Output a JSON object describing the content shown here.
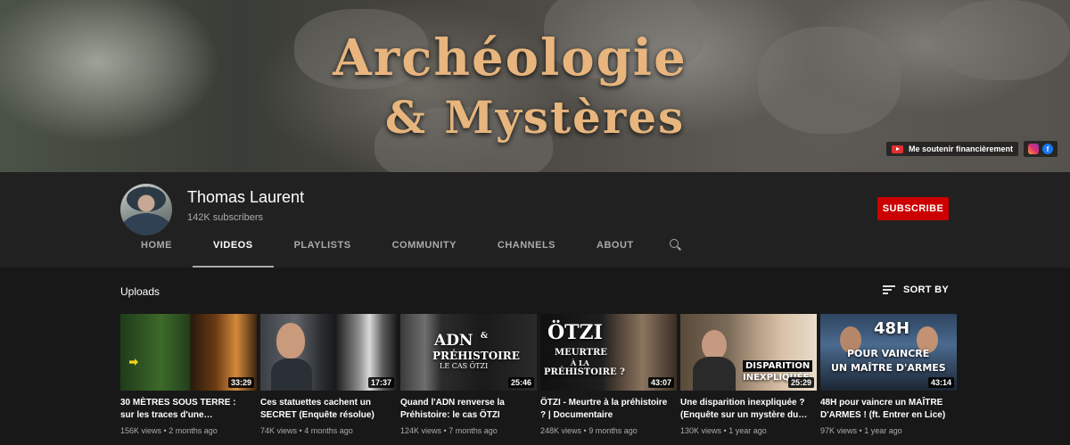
{
  "banner": {
    "title_line1": "Archéologie",
    "title_line2": "& Mystères",
    "support_link": "Me soutenir financièrement",
    "icons": [
      "youtube-icon",
      "instagram-icon",
      "facebook-icon"
    ]
  },
  "channel": {
    "name": "Thomas Laurent",
    "subscribers": "142K subscribers",
    "subscribe_label": "SUBSCRIBE"
  },
  "tabs": [
    {
      "label": "HOME"
    },
    {
      "label": "VIDEOS"
    },
    {
      "label": "PLAYLISTS"
    },
    {
      "label": "COMMUNITY"
    },
    {
      "label": "CHANNELS"
    },
    {
      "label": "ABOUT"
    }
  ],
  "active_tab": "VIDEOS",
  "uploads": {
    "title": "Uploads",
    "sort_label": "SORT BY",
    "videos": [
      {
        "title": "30 MÈTRES SOUS TERRE : sur les traces d'une…",
        "views": "156K views",
        "age": "2 months ago",
        "duration": "33:29",
        "overlay": ""
      },
      {
        "title": "Ces statuettes cachent un SECRET (Enquête résolue)",
        "views": "74K views",
        "age": "4 months ago",
        "duration": "17:37",
        "overlay": ""
      },
      {
        "title": "Quand l'ADN renverse la Préhistoire: le cas ÖTZI",
        "views": "124K views",
        "age": "7 months ago",
        "duration": "25:46",
        "overlay_l1": "ADN",
        "overlay_l2": "&",
        "overlay_l3": "PRÉHISTOIRE",
        "overlay_l4": "LE CAS ÖTZI"
      },
      {
        "title": "ÖTZI - Meurtre à la préhistoire ? | Documentaire",
        "views": "248K views",
        "age": "9 months ago",
        "duration": "43:07",
        "overlay_l1": "ÖTZI",
        "overlay_l2": "MEURTRE",
        "overlay_l3": "À LA",
        "overlay_l4": "PRÉHISTOIRE ?"
      },
      {
        "title": "Une disparition inexpliquée ? (Enquête sur un mystère du…",
        "views": "130K views",
        "age": "1 year ago",
        "duration": "25:29",
        "overlay_l1": "DISPARITION",
        "overlay_l2": "INEXPLIQUÉE"
      },
      {
        "title": "48H pour vaincre un MAÎTRE D'ARMES ! (ft. Entrer en Lice)",
        "views": "97K views",
        "age": "1 year ago",
        "duration": "43:14",
        "overlay_l1": "48H",
        "overlay_l2": "POUR VAINCRE",
        "overlay_l3": "UN MAÎTRE D'ARMES"
      }
    ]
  },
  "colors": {
    "accent_red": "#cc0000",
    "banner_gold": "#e7b57d",
    "page_bg": "#181818",
    "header_bg": "#212121"
  }
}
